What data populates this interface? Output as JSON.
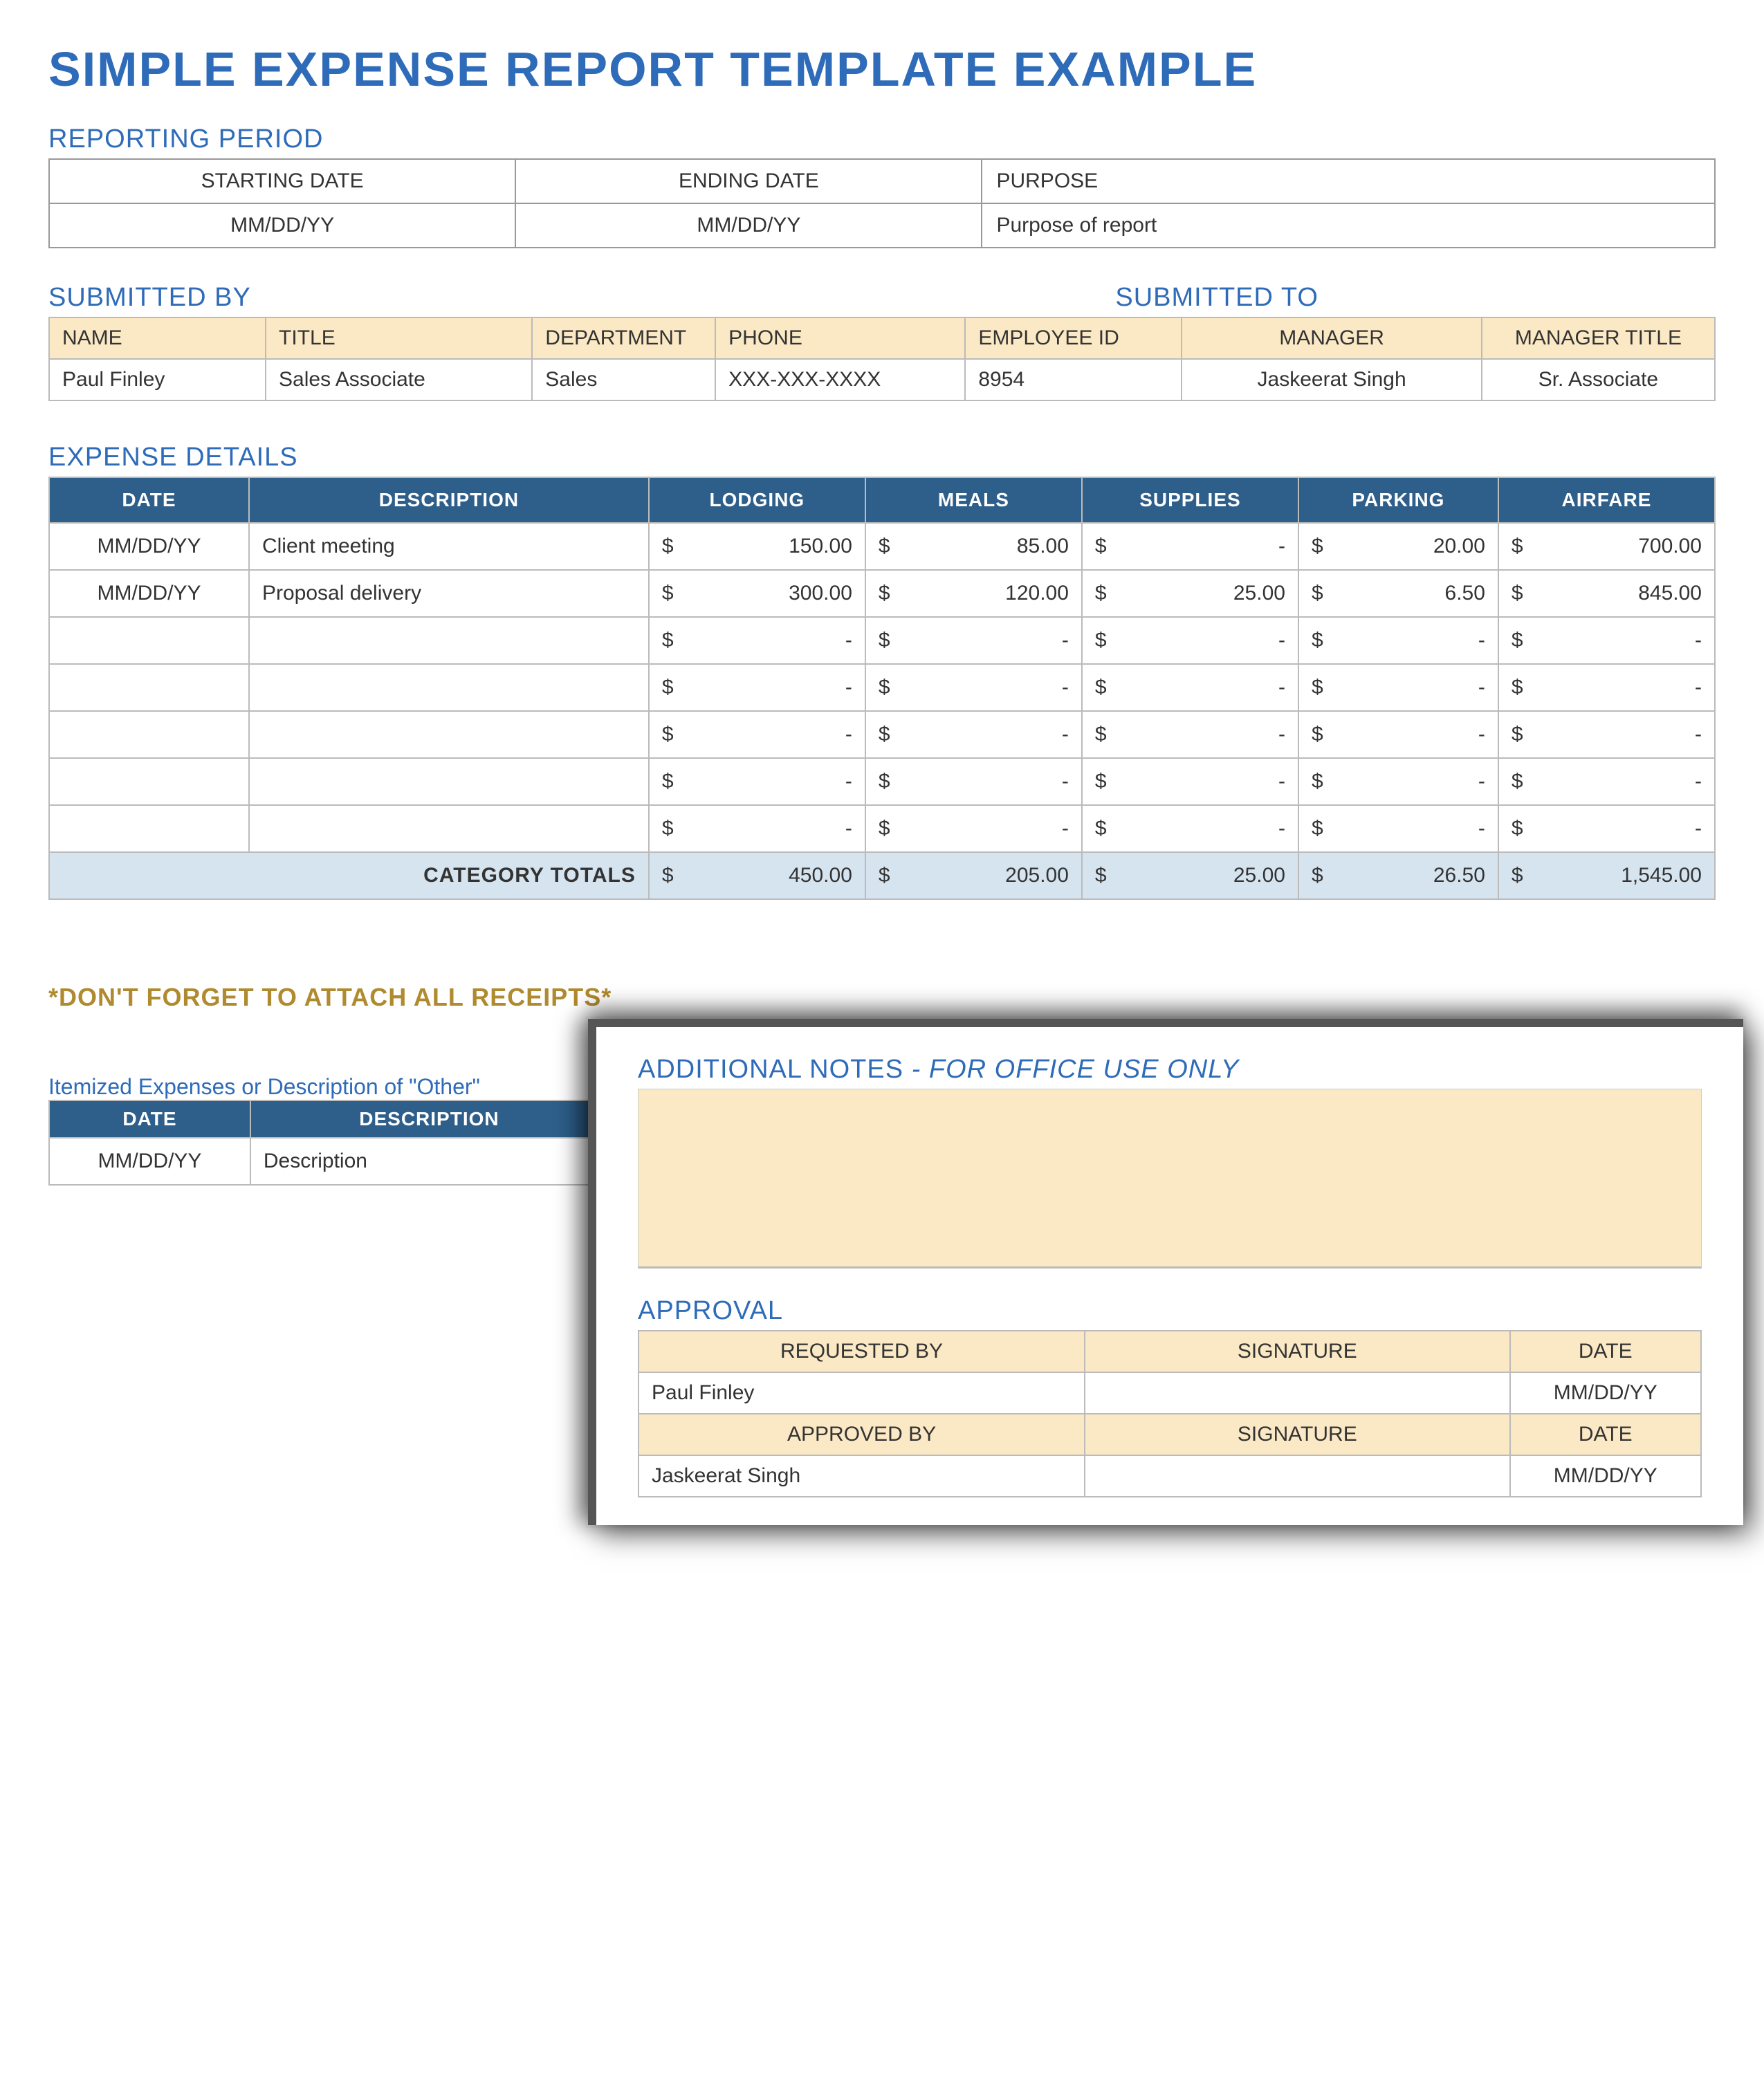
{
  "title": "SIMPLE EXPENSE REPORT TEMPLATE EXAMPLE",
  "sections": {
    "reporting_period": "REPORTING PERIOD",
    "submitted_by": "SUBMITTED BY",
    "submitted_to": "SUBMITTED TO",
    "expense_details": "EXPENSE DETAILS",
    "receipts_warning": "*DON'T FORGET TO ATTACH ALL RECEIPTS*",
    "itemized_label": "Itemized Expenses or Description of \"Other\"",
    "additional_notes": "ADDITIONAL NOTES",
    "additional_notes_suffix": " - FOR OFFICE USE ONLY",
    "approval": "APPROVAL"
  },
  "period": {
    "headers": {
      "start": "STARTING DATE",
      "end": "ENDING DATE",
      "purpose": "PURPOSE"
    },
    "values": {
      "start": "MM/DD/YY",
      "end": "MM/DD/YY",
      "purpose": "Purpose of report"
    }
  },
  "submitted": {
    "headers": {
      "name": "NAME",
      "title": "TITLE",
      "department": "DEPARTMENT",
      "phone": "PHONE",
      "employee_id": "EMPLOYEE ID",
      "manager": "MANAGER",
      "manager_title": "MANAGER TITLE"
    },
    "values": {
      "name": "Paul Finley",
      "title": "Sales Associate",
      "department": "Sales",
      "phone": "XXX-XXX-XXXX",
      "employee_id": "8954",
      "manager": "Jaskeerat Singh",
      "manager_title": "Sr. Associate"
    }
  },
  "expense": {
    "headers": {
      "date": "DATE",
      "description": "DESCRIPTION",
      "lodging": "LODGING",
      "meals": "MEALS",
      "supplies": "SUPPLIES",
      "parking": "PARKING",
      "airfare": "AIRFARE"
    },
    "currency": "$",
    "dash": "-",
    "rows": [
      {
        "date": "MM/DD/YY",
        "desc": "Client meeting",
        "lodging": "150.00",
        "meals": "85.00",
        "supplies": "-",
        "parking": "20.00",
        "airfare": "700.00"
      },
      {
        "date": "MM/DD/YY",
        "desc": "Proposal delivery",
        "lodging": "300.00",
        "meals": "120.00",
        "supplies": "25.00",
        "parking": "6.50",
        "airfare": "845.00"
      },
      {
        "date": "",
        "desc": "",
        "lodging": "-",
        "meals": "-",
        "supplies": "-",
        "parking": "-",
        "airfare": "-"
      },
      {
        "date": "",
        "desc": "",
        "lodging": "-",
        "meals": "-",
        "supplies": "-",
        "parking": "-",
        "airfare": "-"
      },
      {
        "date": "",
        "desc": "",
        "lodging": "-",
        "meals": "-",
        "supplies": "-",
        "parking": "-",
        "airfare": "-"
      },
      {
        "date": "",
        "desc": "",
        "lodging": "-",
        "meals": "-",
        "supplies": "-",
        "parking": "-",
        "airfare": "-"
      },
      {
        "date": "",
        "desc": "",
        "lodging": "-",
        "meals": "-",
        "supplies": "-",
        "parking": "-",
        "airfare": "-"
      }
    ],
    "totals_label": "CATEGORY TOTALS",
    "totals": {
      "lodging": "450.00",
      "meals": "205.00",
      "supplies": "25.00",
      "parking": "26.50",
      "airfare": "1,545.00"
    }
  },
  "itemized": {
    "headers": {
      "date": "DATE",
      "description": "DESCRIPTION"
    },
    "row": {
      "date": "MM/DD/YY",
      "desc": "Description"
    }
  },
  "approval": {
    "headers": {
      "requested_by": "REQUESTED BY",
      "signature": "SIGNATURE",
      "date": "DATE",
      "approved_by": "APPROVED BY"
    },
    "requested": {
      "name": "Paul Finley",
      "signature": "",
      "date": "MM/DD/YY"
    },
    "approved": {
      "name": "Jaskeerat Singh",
      "signature": "",
      "date": "MM/DD/YY"
    }
  }
}
